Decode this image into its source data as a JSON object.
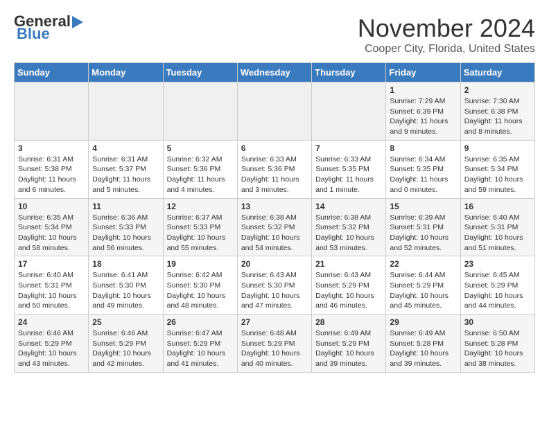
{
  "header": {
    "logo_line1": "General",
    "logo_line2": "Blue",
    "title": "November 2024",
    "subtitle": "Cooper City, Florida, United States"
  },
  "weekdays": [
    "Sunday",
    "Monday",
    "Tuesday",
    "Wednesday",
    "Thursday",
    "Friday",
    "Saturday"
  ],
  "weeks": [
    [
      {
        "day": "",
        "content": ""
      },
      {
        "day": "",
        "content": ""
      },
      {
        "day": "",
        "content": ""
      },
      {
        "day": "",
        "content": ""
      },
      {
        "day": "",
        "content": ""
      },
      {
        "day": "1",
        "content": "Sunrise: 7:29 AM\nSunset: 6:39 PM\nDaylight: 11 hours and 9 minutes."
      },
      {
        "day": "2",
        "content": "Sunrise: 7:30 AM\nSunset: 6:38 PM\nDaylight: 11 hours and 8 minutes."
      }
    ],
    [
      {
        "day": "3",
        "content": "Sunrise: 6:31 AM\nSunset: 5:38 PM\nDaylight: 11 hours and 6 minutes."
      },
      {
        "day": "4",
        "content": "Sunrise: 6:31 AM\nSunset: 5:37 PM\nDaylight: 11 hours and 5 minutes."
      },
      {
        "day": "5",
        "content": "Sunrise: 6:32 AM\nSunset: 5:36 PM\nDaylight: 11 hours and 4 minutes."
      },
      {
        "day": "6",
        "content": "Sunrise: 6:33 AM\nSunset: 5:36 PM\nDaylight: 11 hours and 3 minutes."
      },
      {
        "day": "7",
        "content": "Sunrise: 6:33 AM\nSunset: 5:35 PM\nDaylight: 11 hours and 1 minute."
      },
      {
        "day": "8",
        "content": "Sunrise: 6:34 AM\nSunset: 5:35 PM\nDaylight: 11 hours and 0 minutes."
      },
      {
        "day": "9",
        "content": "Sunrise: 6:35 AM\nSunset: 5:34 PM\nDaylight: 10 hours and 59 minutes."
      }
    ],
    [
      {
        "day": "10",
        "content": "Sunrise: 6:35 AM\nSunset: 5:34 PM\nDaylight: 10 hours and 58 minutes."
      },
      {
        "day": "11",
        "content": "Sunrise: 6:36 AM\nSunset: 5:33 PM\nDaylight: 10 hours and 56 minutes."
      },
      {
        "day": "12",
        "content": "Sunrise: 6:37 AM\nSunset: 5:33 PM\nDaylight: 10 hours and 55 minutes."
      },
      {
        "day": "13",
        "content": "Sunrise: 6:38 AM\nSunset: 5:32 PM\nDaylight: 10 hours and 54 minutes."
      },
      {
        "day": "14",
        "content": "Sunrise: 6:38 AM\nSunset: 5:32 PM\nDaylight: 10 hours and 53 minutes."
      },
      {
        "day": "15",
        "content": "Sunrise: 6:39 AM\nSunset: 5:31 PM\nDaylight: 10 hours and 52 minutes."
      },
      {
        "day": "16",
        "content": "Sunrise: 6:40 AM\nSunset: 5:31 PM\nDaylight: 10 hours and 51 minutes."
      }
    ],
    [
      {
        "day": "17",
        "content": "Sunrise: 6:40 AM\nSunset: 5:31 PM\nDaylight: 10 hours and 50 minutes."
      },
      {
        "day": "18",
        "content": "Sunrise: 6:41 AM\nSunset: 5:30 PM\nDaylight: 10 hours and 49 minutes."
      },
      {
        "day": "19",
        "content": "Sunrise: 6:42 AM\nSunset: 5:30 PM\nDaylight: 10 hours and 48 minutes."
      },
      {
        "day": "20",
        "content": "Sunrise: 6:43 AM\nSunset: 5:30 PM\nDaylight: 10 hours and 47 minutes."
      },
      {
        "day": "21",
        "content": "Sunrise: 6:43 AM\nSunset: 5:29 PM\nDaylight: 10 hours and 46 minutes."
      },
      {
        "day": "22",
        "content": "Sunrise: 6:44 AM\nSunset: 5:29 PM\nDaylight: 10 hours and 45 minutes."
      },
      {
        "day": "23",
        "content": "Sunrise: 6:45 AM\nSunset: 5:29 PM\nDaylight: 10 hours and 44 minutes."
      }
    ],
    [
      {
        "day": "24",
        "content": "Sunrise: 6:46 AM\nSunset: 5:29 PM\nDaylight: 10 hours and 43 minutes."
      },
      {
        "day": "25",
        "content": "Sunrise: 6:46 AM\nSunset: 5:29 PM\nDaylight: 10 hours and 42 minutes."
      },
      {
        "day": "26",
        "content": "Sunrise: 6:47 AM\nSunset: 5:29 PM\nDaylight: 10 hours and 41 minutes."
      },
      {
        "day": "27",
        "content": "Sunrise: 6:48 AM\nSunset: 5:29 PM\nDaylight: 10 hours and 40 minutes."
      },
      {
        "day": "28",
        "content": "Sunrise: 6:49 AM\nSunset: 5:29 PM\nDaylight: 10 hours and 39 minutes."
      },
      {
        "day": "29",
        "content": "Sunrise: 6:49 AM\nSunset: 5:28 PM\nDaylight: 10 hours and 39 minutes."
      },
      {
        "day": "30",
        "content": "Sunrise: 6:50 AM\nSunset: 5:28 PM\nDaylight: 10 hours and 38 minutes."
      }
    ]
  ]
}
